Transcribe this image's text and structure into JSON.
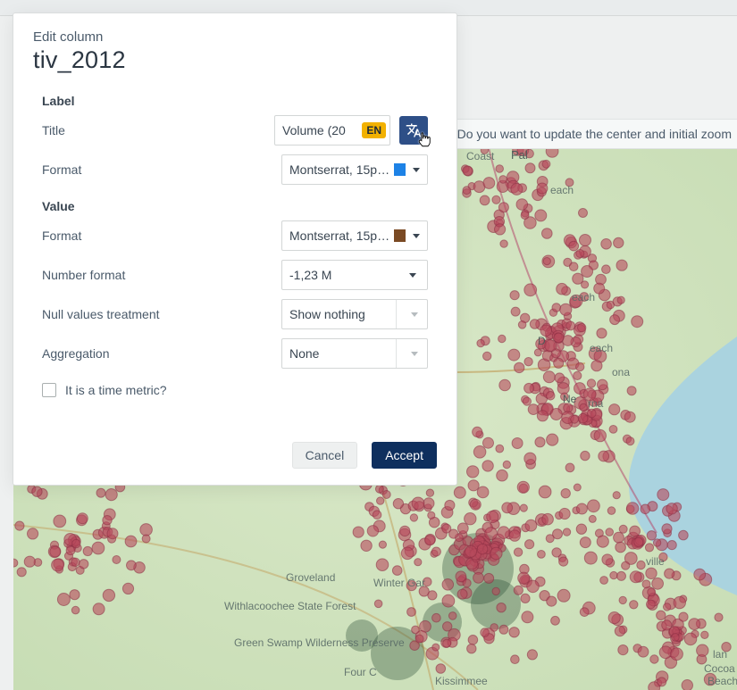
{
  "info_bar": {
    "text": "Do you want to update the center and initial zoom "
  },
  "modal": {
    "subtitle": "Edit column",
    "title": "tiv_2012",
    "sections": {
      "label": {
        "heading": "Label",
        "rows": {
          "title": {
            "label": "Title",
            "input_value": "Volume (20",
            "lang_code": "EN"
          },
          "format": {
            "label": "Format",
            "value": "Montserrat, 15px…",
            "swatch_color": "#1d82e6"
          }
        }
      },
      "value": {
        "heading": "Value",
        "rows": {
          "format": {
            "label": "Format",
            "value": "Montserrat, 15px…",
            "swatch_color": "#7a4a24"
          },
          "number_format": {
            "label": "Number format",
            "value": "-1,23 M"
          },
          "null_values": {
            "label": "Null values treatment",
            "value": "Show nothing"
          },
          "aggregation": {
            "label": "Aggregation",
            "value": "None"
          }
        }
      }
    },
    "checkbox": {
      "label": "It is a time metric?"
    },
    "footer": {
      "cancel": "Cancel",
      "accept": "Accept"
    }
  },
  "icons": {
    "translate_label": "translate-icon"
  }
}
